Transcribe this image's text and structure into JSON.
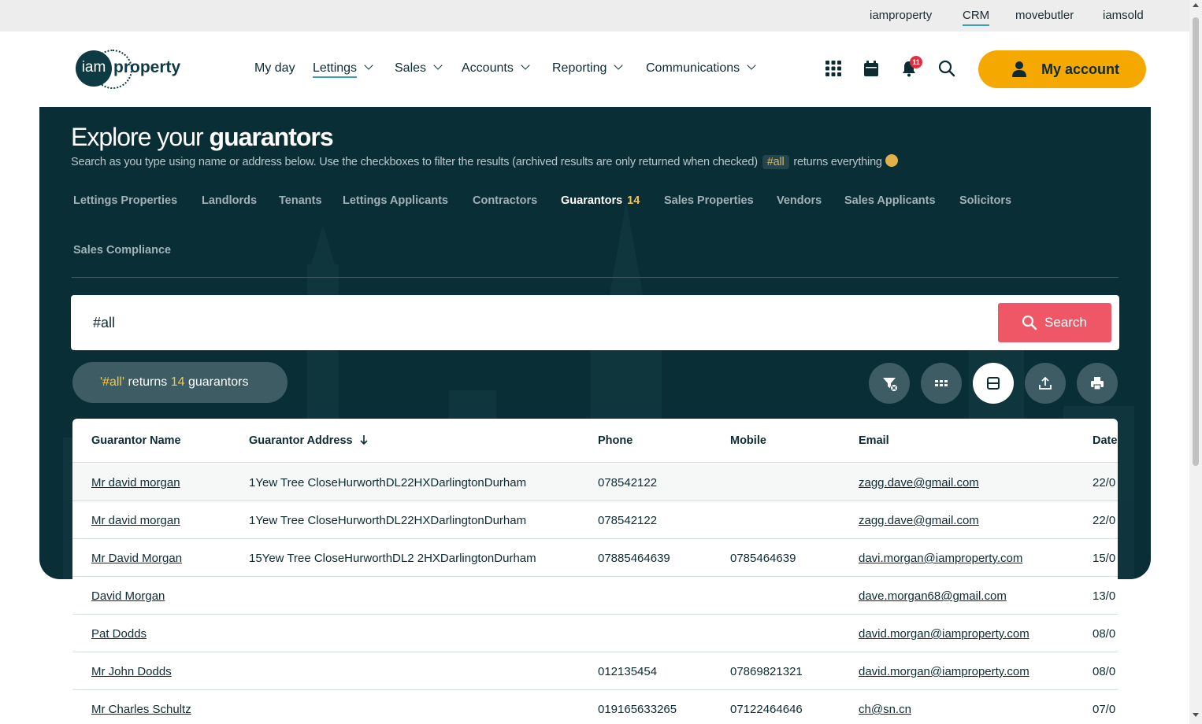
{
  "topbar": {
    "links": [
      "iamproperty",
      "CRM",
      "movebutler",
      "iamsold"
    ],
    "active": "CRM"
  },
  "header": {
    "logo": {
      "mark": "iam",
      "word": "property"
    },
    "nav": [
      "My day",
      "Lettings",
      "Sales",
      "Accounts",
      "Reporting",
      "Communications"
    ],
    "active_nav": "Lettings",
    "notification_count": "11",
    "account_label": "My account",
    "icons": [
      "apps-grid-icon",
      "calendar-icon",
      "bell-icon",
      "search-icon",
      "user-icon"
    ]
  },
  "hero": {
    "title_light": "Explore your ",
    "title_bold": "guarantors",
    "subtitle_before": "Search as you type using name or address below. Use the checkboxes to filter the results (archived results are only returned when checked)",
    "subtitle_tag": "#all",
    "subtitle_after": "returns everything"
  },
  "tabs": [
    {
      "label": "Lettings Properties"
    },
    {
      "label": "Landlords"
    },
    {
      "label": "Tenants"
    },
    {
      "label": "Lettings Applicants"
    },
    {
      "label": "Contractors"
    },
    {
      "label": "Guarantors",
      "count": "14",
      "active": true
    },
    {
      "label": "Sales Properties"
    },
    {
      "label": "Vendors"
    },
    {
      "label": "Sales Applicants"
    },
    {
      "label": "Solicitors"
    },
    {
      "label": "Sales Compliance"
    }
  ],
  "search": {
    "value": "#all",
    "button_label": "Search"
  },
  "results": {
    "query": "'#all'",
    "middle": " returns ",
    "count": "14",
    "noun": " guarantors"
  },
  "toolbar_icons": [
    "clear-filter-icon",
    "grid-view-icon",
    "table-view-icon",
    "export-icon",
    "print-icon"
  ],
  "table": {
    "columns": [
      "Guarantor Name",
      "Guarantor Address",
      "Phone",
      "Mobile",
      "Email",
      "Date"
    ],
    "sorted_column": "Guarantor Address",
    "rows": [
      {
        "name": "Mr david morgan",
        "address": "1Yew Tree CloseHurworthDL22HXDarlingtonDurham",
        "phone": "078542122",
        "mobile": "",
        "email": "zagg.dave@gmail.com",
        "date": "22/0"
      },
      {
        "name": "Mr david morgan",
        "address": "1Yew Tree CloseHurworthDL22HXDarlingtonDurham",
        "phone": "078542122",
        "mobile": "",
        "email": "zagg.dave@gmail.com",
        "date": "22/0"
      },
      {
        "name": "Mr David Morgan",
        "address": "15Yew Tree CloseHurworthDL2 2HXDarlingtonDurham",
        "phone": "07885464639",
        "mobile": "0785464639",
        "email": "davi.morgan@iamproperty.com",
        "date": "15/0"
      },
      {
        "name": "David Morgan",
        "address": "",
        "phone": "",
        "mobile": "",
        "email": "dave.morgan68@gmail.com",
        "date": "13/0"
      },
      {
        "name": "Pat Dodds",
        "address": "",
        "phone": "",
        "mobile": "",
        "email": "david.morgan@iamproperty.com",
        "date": "08/0"
      },
      {
        "name": "Mr John Dodds",
        "address": "",
        "phone": "012135454",
        "mobile": "07869821321",
        "email": "david.morgan@iamproperty.com",
        "date": "08/0"
      },
      {
        "name": "Mr Charles Schultz",
        "address": "",
        "phone": "019165633265",
        "mobile": "07122464646",
        "email": "ch@sn.cn",
        "date": "07/0"
      }
    ]
  }
}
